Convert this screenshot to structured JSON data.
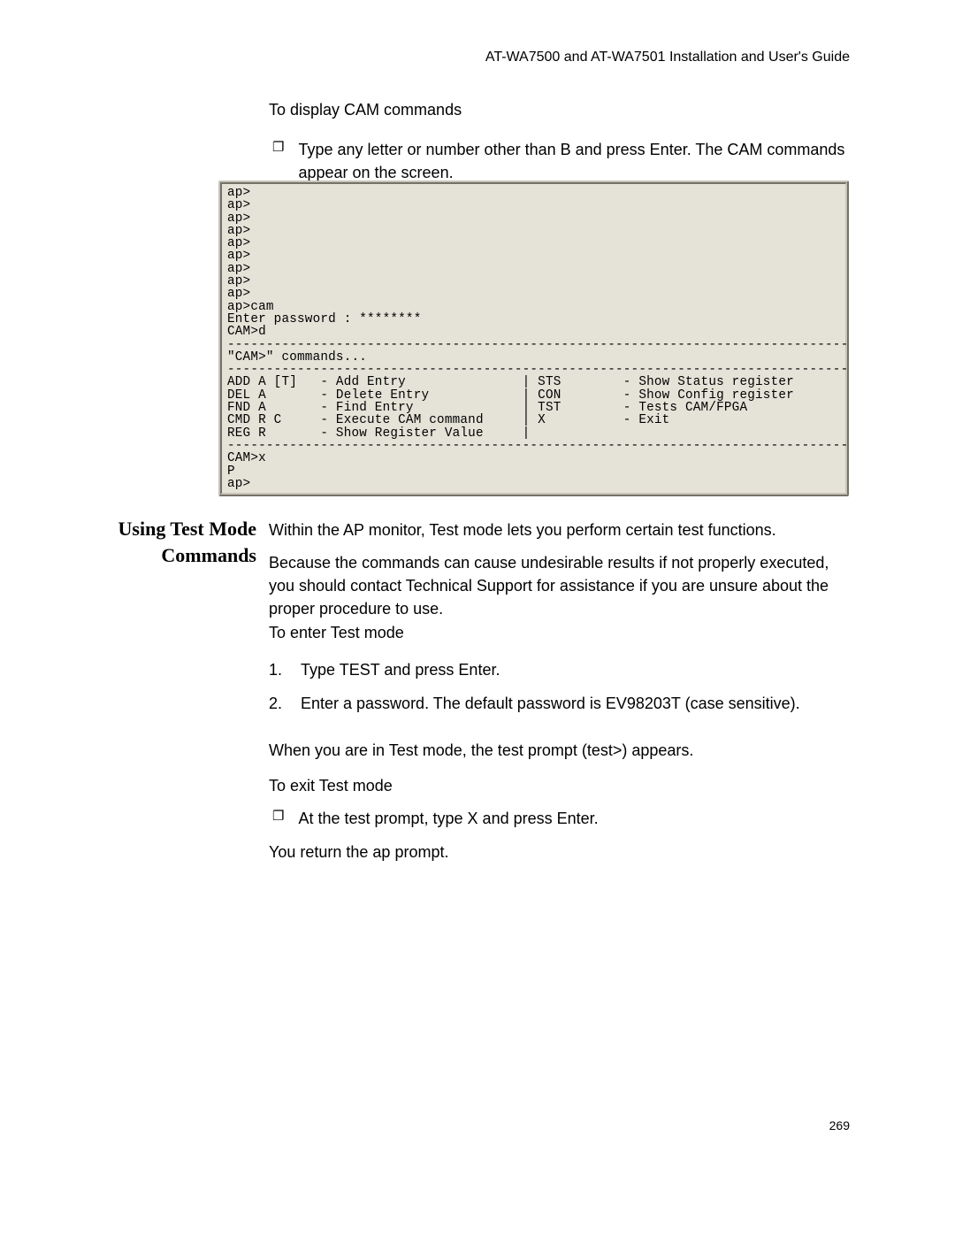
{
  "header": {
    "title": "AT-WA7500 and AT-WA7501 Installation and User's Guide"
  },
  "section1": {
    "heading": "To display CAM commands",
    "bullet": "Type any letter or number other than B and press Enter. The CAM commands appear on the screen."
  },
  "terminal": {
    "content": "ap>\nap>\nap>\nap>\nap>\nap>\nap>\nap>\nap>\nap>cam\nEnter password : ********\nCAM>d\n--------------------------------------------------------------------------------\n\"CAM>\" commands...\n--------------------------------------------------------------------------------\nADD A [T]   - Add Entry               | STS        - Show Status register\nDEL A       - Delete Entry            | CON        - Show Config register\nFND A       - Find Entry              | TST        - Tests CAM/FPGA\nCMD R C     - Execute CAM command     | X          - Exit\nREG R       - Show Register Value     |\n--------------------------------------------------------------------------------\nCAM>x\nP\nap>"
  },
  "section2": {
    "heading": "Using Test Mode Commands",
    "p1": "Within the AP monitor, Test mode lets you perform certain test functions.",
    "p2": "Because the commands can cause undesirable results if not properly executed, you should contact Technical Support for assistance if you are unsure about the proper procedure to use.",
    "p3": "To enter Test mode",
    "ol": {
      "item1_num": "1.",
      "item1_text": "Type TEST and press Enter.",
      "item2_num": "2.",
      "item2_text": "Enter a password. The default password is EV98203T (case sensitive)."
    },
    "p4": "When you are in Test mode, the test prompt (test>) appears.",
    "p5": "To exit Test mode",
    "bullet": "At the test prompt, type X and press Enter.",
    "p6": "You return the ap prompt."
  },
  "footer": {
    "page": "269"
  },
  "icons": {
    "box_bullet": "❐"
  }
}
